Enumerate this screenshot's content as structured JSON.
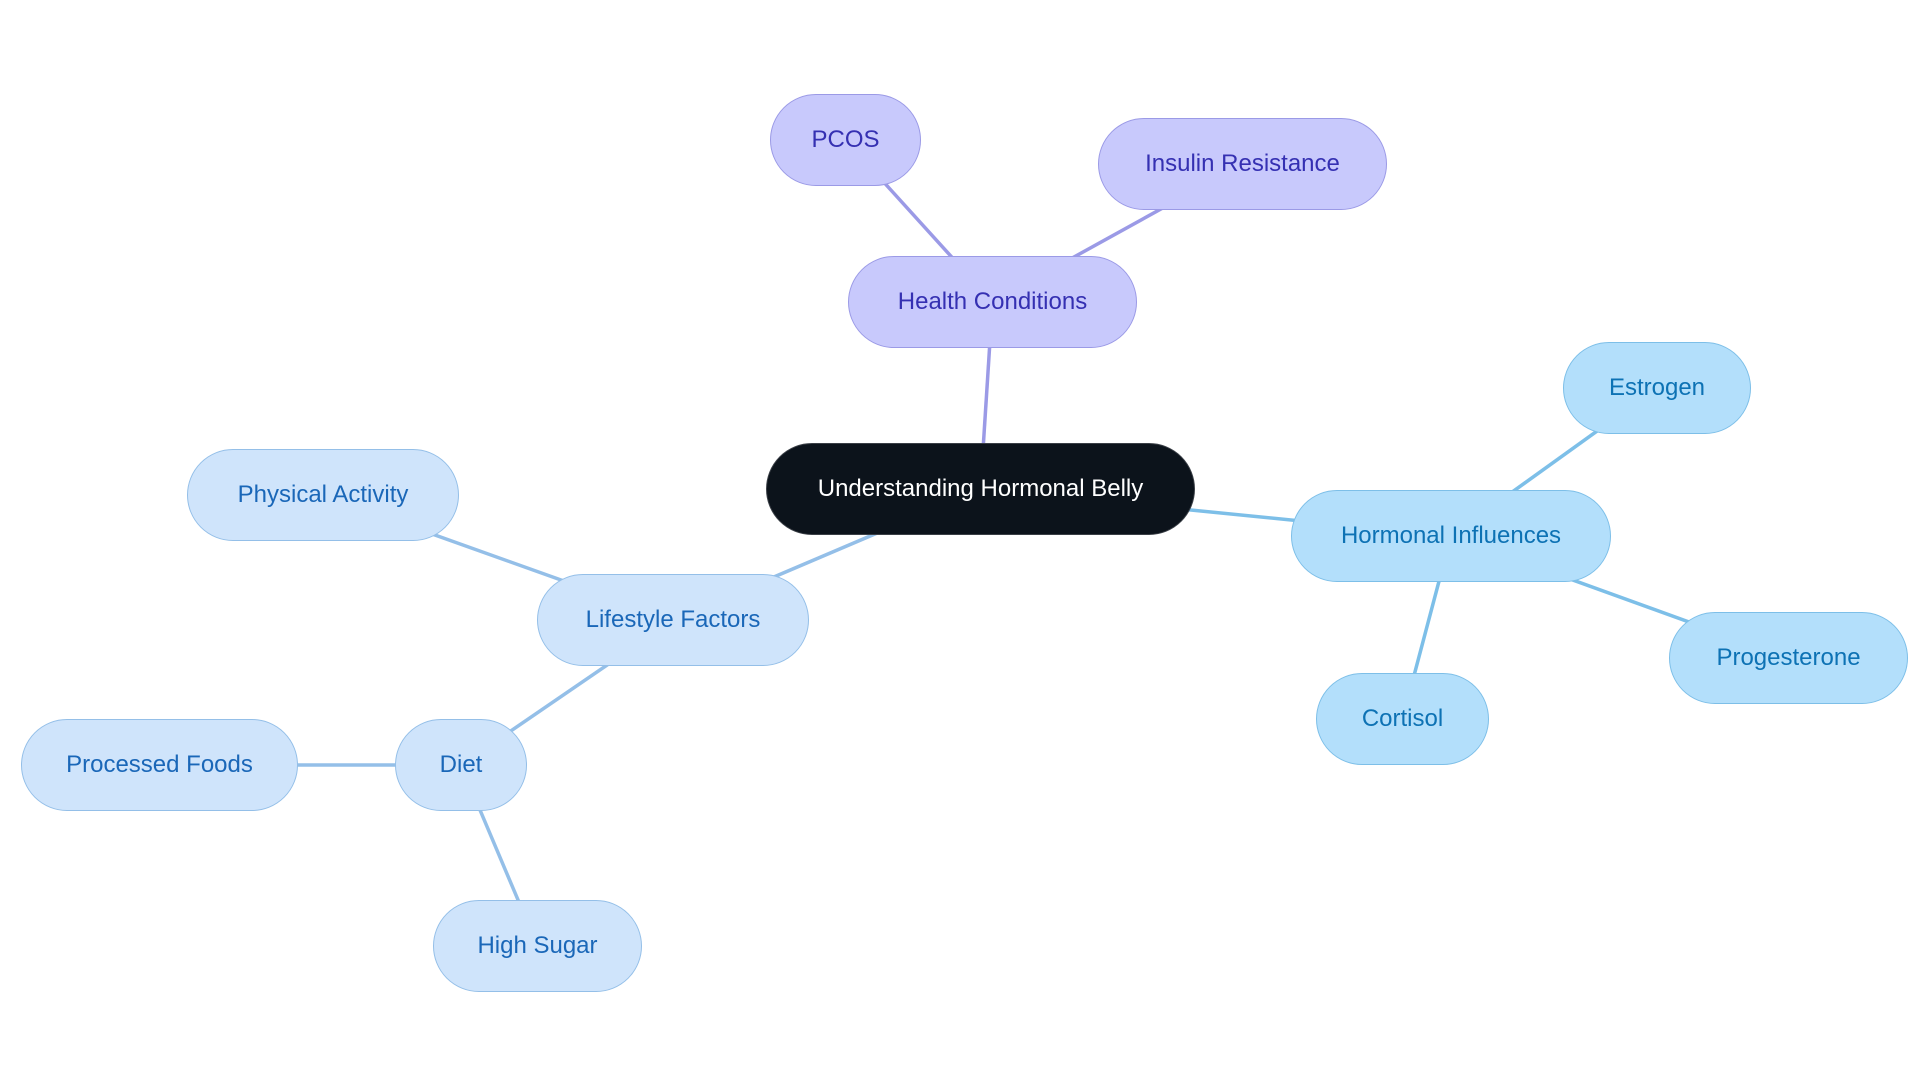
{
  "diagram": {
    "type": "mind-map",
    "root": {
      "id": "root",
      "label": "Understanding Hormonal Belly"
    },
    "nodes": [
      {
        "id": "health",
        "label": "Health Conditions",
        "parent": "root",
        "theme": "purple"
      },
      {
        "id": "pcos",
        "label": "PCOS",
        "parent": "health",
        "theme": "purple"
      },
      {
        "id": "insulin",
        "label": "Insulin Resistance",
        "parent": "health",
        "theme": "purple"
      },
      {
        "id": "hormonal",
        "label": "Hormonal Influences",
        "parent": "root",
        "theme": "sky"
      },
      {
        "id": "estrogen",
        "label": "Estrogen",
        "parent": "hormonal",
        "theme": "sky"
      },
      {
        "id": "progesterone",
        "label": "Progesterone",
        "parent": "hormonal",
        "theme": "sky"
      },
      {
        "id": "cortisol",
        "label": "Cortisol",
        "parent": "hormonal",
        "theme": "sky"
      },
      {
        "id": "lifestyle",
        "label": "Lifestyle Factors",
        "parent": "root",
        "theme": "pale"
      },
      {
        "id": "physical",
        "label": "Physical Activity",
        "parent": "lifestyle",
        "theme": "pale"
      },
      {
        "id": "diet",
        "label": "Diet",
        "parent": "lifestyle",
        "theme": "pale"
      },
      {
        "id": "processed",
        "label": "Processed Foods",
        "parent": "diet",
        "theme": "pale"
      },
      {
        "id": "sugar",
        "label": "High Sugar",
        "parent": "diet",
        "theme": "pale"
      }
    ],
    "colors": {
      "root_fill": "#0c131b",
      "root_text": "#ffffff",
      "purple_fill": "#c8c9fc",
      "purple_text": "#3530b2",
      "purple_edge": "#9b9ae6",
      "sky_fill": "#b3dffb",
      "sky_text": "#0d72b4",
      "sky_edge": "#7dbfe8",
      "pale_fill": "#cfe4fb",
      "pale_text": "#1a67b8",
      "pale_edge": "#94bfe8"
    }
  }
}
